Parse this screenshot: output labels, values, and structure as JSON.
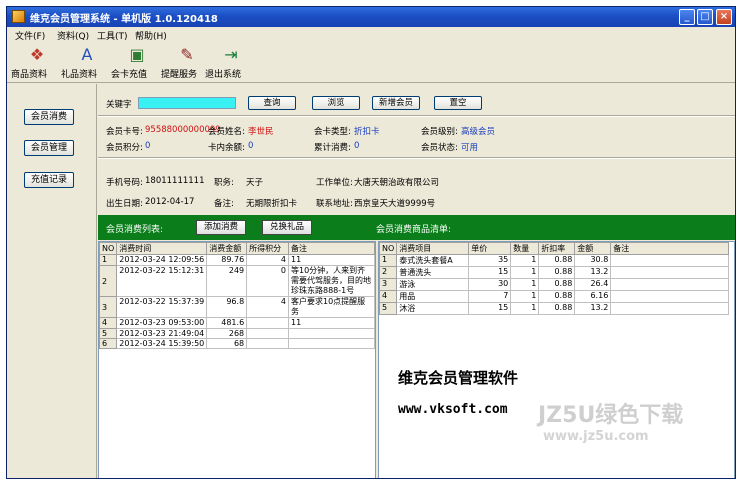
{
  "window": {
    "title": "维克会员管理系统 - 单机版 1.0.120418",
    "min": "_",
    "max": "□",
    "close": "×"
  },
  "menu": [
    "文件(F)",
    "资料(Q)",
    "工具(T)",
    "帮助(H)"
  ],
  "toolbar": [
    {
      "label": "商品资料",
      "icon": "products-icon",
      "glyph": "❖",
      "color": "#c0392b"
    },
    {
      "label": "礼品资料",
      "icon": "gift-book-icon",
      "glyph": "A",
      "color": "#1f4fbf"
    },
    {
      "label": "会卡充值",
      "icon": "card-recharge-icon",
      "glyph": "▣",
      "color": "#2e7d32"
    },
    {
      "label": "提醒服务",
      "icon": "reminder-icon",
      "glyph": "✎",
      "color": "#8e2424"
    },
    {
      "label": "退出系统",
      "icon": "exit-icon",
      "glyph": "⇥",
      "color": "#1b7e3a"
    }
  ],
  "sidebar": [
    "会员消费",
    "会员管理",
    "充值记录"
  ],
  "search": {
    "label": "关键字",
    "value": "",
    "buttons": [
      "查询",
      "浏览",
      "新增会员",
      "置空"
    ]
  },
  "member": {
    "card_no_label": "会员卡号:",
    "card_no": "95588000000099",
    "name_label": "会员姓名:",
    "name": "李世民",
    "card_type_label": "会卡类型:",
    "card_type": "折扣卡",
    "level_label": "会员级别:",
    "level": "高级会员",
    "points_label": "会员积分:",
    "points": "0",
    "balance_label": "卡内余额:",
    "balance": "0",
    "total_label": "累计消费:",
    "total": "0",
    "status_label": "会员状态:",
    "status": "可用",
    "phone_label": "手机号码:",
    "phone": "18011111111",
    "job_label": "职务:",
    "job": "天子",
    "work_label": "工作单位:",
    "work": "大唐天朝治政有限公司",
    "birth_label": "出生日期:",
    "birth": "2012-04-17",
    "remark_label": "备注:",
    "remark": "无期限折扣卡",
    "address_label": "联系地址:",
    "address": "西京皇天大道9999号"
  },
  "consume": {
    "title": "会员消费列表:",
    "add_button": "添加消费",
    "gift_button": "兑换礼品",
    "columns": [
      "NO",
      "消费时间",
      "消费金额",
      "所得积分",
      "备注"
    ],
    "rows": [
      {
        "no": "1",
        "time": "2012-03-24 12:09:56",
        "amount": "89.76",
        "points": "4",
        "note": "11"
      },
      {
        "no": "2",
        "time": "2012-03-22 15:12:31",
        "amount": "249",
        "points": "0",
        "note": "等10分钟，人来到齐需要代驾服务，目的地珍珠东路888-1号"
      },
      {
        "no": "3",
        "time": "2012-03-22 15:37:39",
        "amount": "96.8",
        "points": "4",
        "note": "客户要求10点提醒服务"
      },
      {
        "no": "4",
        "time": "2012-03-23 09:53:00",
        "amount": "481.6",
        "points": "",
        "note": "11"
      },
      {
        "no": "5",
        "time": "2012-03-23 21:49:04",
        "amount": "268",
        "points": "",
        "note": ""
      },
      {
        "no": "6",
        "time": "2012-03-24 15:39:50",
        "amount": "68",
        "points": "",
        "note": ""
      }
    ]
  },
  "goods": {
    "title": "会员消费商品清单:",
    "columns": [
      "NO",
      "消费项目",
      "单价",
      "数量",
      "折扣率",
      "金额",
      "备注"
    ],
    "rows": [
      {
        "no": "1",
        "item": "泰式洗头套餐A",
        "price": "35",
        "qty": "1",
        "discount": "0.88",
        "amount": "30.8",
        "note": ""
      },
      {
        "no": "2",
        "item": "普通洗头",
        "price": "15",
        "qty": "1",
        "discount": "0.88",
        "amount": "13.2",
        "note": ""
      },
      {
        "no": "3",
        "item": "游泳",
        "price": "30",
        "qty": "1",
        "discount": "0.88",
        "amount": "26.4",
        "note": ""
      },
      {
        "no": "4",
        "item": "用品",
        "price": "7",
        "qty": "1",
        "discount": "0.88",
        "amount": "6.16",
        "note": ""
      },
      {
        "no": "5",
        "item": "沐浴",
        "price": "15",
        "qty": "1",
        "discount": "0.88",
        "amount": "13.2",
        "note": ""
      }
    ]
  },
  "promo": {
    "line1": "维克会员管理软件",
    "line2": "www.vksoft.com"
  },
  "watermark": {
    "line1": "JZ5U绿色下载",
    "line2": "www.jz5u.com"
  }
}
